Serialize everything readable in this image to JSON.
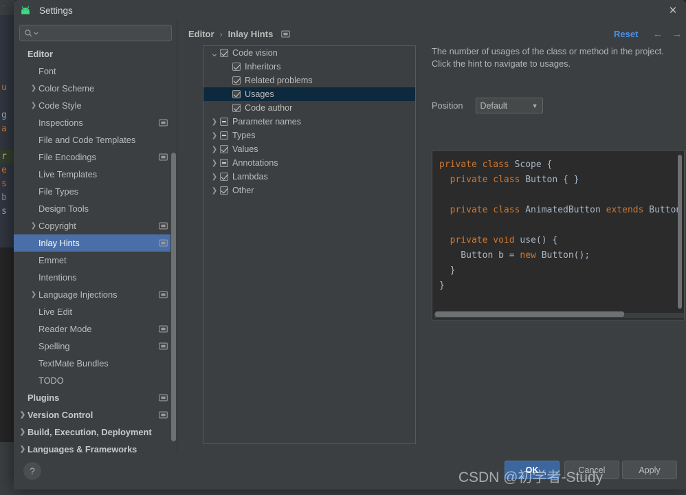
{
  "window": {
    "title": "Settings",
    "logo_icon": "android-logo-icon",
    "close_icon": "close-icon"
  },
  "search": {
    "placeholder": "",
    "value": "",
    "icon": "search-icon",
    "dropdown_icon": "chevron-down-icon"
  },
  "sidebar": {
    "scrollbar": "vertical-scrollbar",
    "items": [
      {
        "label": "Editor",
        "indent": 0,
        "bold": true,
        "arrow": "",
        "config_icon": false
      },
      {
        "label": "Font",
        "indent": 1,
        "bold": false,
        "arrow": "",
        "config_icon": false
      },
      {
        "label": "Color Scheme",
        "indent": 1,
        "bold": false,
        "arrow": "chevron-right-icon",
        "config_icon": false
      },
      {
        "label": "Code Style",
        "indent": 1,
        "bold": false,
        "arrow": "chevron-right-icon",
        "config_icon": false
      },
      {
        "label": "Inspections",
        "indent": 1,
        "bold": false,
        "arrow": "",
        "config_icon": true
      },
      {
        "label": "File and Code Templates",
        "indent": 1,
        "bold": false,
        "arrow": "",
        "config_icon": false
      },
      {
        "label": "File Encodings",
        "indent": 1,
        "bold": false,
        "arrow": "",
        "config_icon": true
      },
      {
        "label": "Live Templates",
        "indent": 1,
        "bold": false,
        "arrow": "",
        "config_icon": false
      },
      {
        "label": "File Types",
        "indent": 1,
        "bold": false,
        "arrow": "",
        "config_icon": false
      },
      {
        "label": "Design Tools",
        "indent": 1,
        "bold": false,
        "arrow": "",
        "config_icon": false
      },
      {
        "label": "Copyright",
        "indent": 1,
        "bold": false,
        "arrow": "chevron-right-icon",
        "config_icon": true
      },
      {
        "label": "Inlay Hints",
        "indent": 1,
        "bold": false,
        "arrow": "",
        "config_icon": true,
        "selected": true
      },
      {
        "label": "Emmet",
        "indent": 1,
        "bold": false,
        "arrow": "",
        "config_icon": false
      },
      {
        "label": "Intentions",
        "indent": 1,
        "bold": false,
        "arrow": "",
        "config_icon": false
      },
      {
        "label": "Language Injections",
        "indent": 1,
        "bold": false,
        "arrow": "chevron-right-icon",
        "config_icon": true
      },
      {
        "label": "Live Edit",
        "indent": 1,
        "bold": false,
        "arrow": "",
        "config_icon": false
      },
      {
        "label": "Reader Mode",
        "indent": 1,
        "bold": false,
        "arrow": "",
        "config_icon": true
      },
      {
        "label": "Spelling",
        "indent": 1,
        "bold": false,
        "arrow": "",
        "config_icon": true
      },
      {
        "label": "TextMate Bundles",
        "indent": 1,
        "bold": false,
        "arrow": "",
        "config_icon": false
      },
      {
        "label": "TODO",
        "indent": 1,
        "bold": false,
        "arrow": "",
        "config_icon": false
      },
      {
        "label": "Plugins",
        "indent": 0,
        "bold": true,
        "arrow": "",
        "config_icon": true
      },
      {
        "label": "Version Control",
        "indent": 0,
        "bold": true,
        "arrow": "chevron-right-icon",
        "config_icon": true
      },
      {
        "label": "Build, Execution, Deployment",
        "indent": 0,
        "bold": true,
        "arrow": "chevron-right-icon",
        "config_icon": false
      },
      {
        "label": "Languages & Frameworks",
        "indent": 0,
        "bold": true,
        "arrow": "chevron-right-icon",
        "config_icon": false
      }
    ]
  },
  "breadcrumb": {
    "root": "Editor",
    "separator": "›",
    "current": "Inlay Hints",
    "config_icon": "scope-indicator-icon"
  },
  "actions": {
    "reset_label": "Reset",
    "back_icon": "arrow-left-icon",
    "forward_icon": "arrow-right-icon"
  },
  "hint_tree": {
    "rows": [
      {
        "label": "Code vision",
        "indent": 0,
        "arrow": "chevron-down-icon",
        "checkbox": "checked"
      },
      {
        "label": "Inheritors",
        "indent": 1,
        "arrow": "",
        "checkbox": "checked"
      },
      {
        "label": "Related problems",
        "indent": 1,
        "arrow": "",
        "checkbox": "checked"
      },
      {
        "label": "Usages",
        "indent": 1,
        "arrow": "",
        "checkbox": "checked",
        "selected": true
      },
      {
        "label": "Code author",
        "indent": 1,
        "arrow": "",
        "checkbox": "checked"
      },
      {
        "label": "Parameter names",
        "indent": 0,
        "arrow": "chevron-right-icon",
        "checkbox": "dash"
      },
      {
        "label": "Types",
        "indent": 0,
        "arrow": "chevron-right-icon",
        "checkbox": "dash"
      },
      {
        "label": "Values",
        "indent": 0,
        "arrow": "chevron-right-icon",
        "checkbox": "checked"
      },
      {
        "label": "Annotations",
        "indent": 0,
        "arrow": "chevron-right-icon",
        "checkbox": "dash"
      },
      {
        "label": "Lambdas",
        "indent": 0,
        "arrow": "chevron-right-icon",
        "checkbox": "checked"
      },
      {
        "label": "Other",
        "indent": 0,
        "arrow": "chevron-right-icon",
        "checkbox": "checked"
      }
    ]
  },
  "detail": {
    "description": "The number of usages of the class or method in the project. Click the hint to navigate to usages.",
    "position_label": "Position",
    "position_value": "Default",
    "position_caret": "chevron-down-icon",
    "code_preview": [
      {
        "segments": [
          {
            "t": "private class ",
            "k": true
          },
          {
            "t": "Scope {",
            "k": false
          }
        ]
      },
      {
        "segments": [
          {
            "t": "  private class ",
            "k": true
          },
          {
            "t": "Button { }",
            "k": false
          }
        ]
      },
      {
        "segments": [
          {
            "t": "",
            "k": false
          }
        ]
      },
      {
        "segments": [
          {
            "t": "  private class ",
            "k": true
          },
          {
            "t": "AnimatedButton ",
            "k": false
          },
          {
            "t": "extends ",
            "k": true
          },
          {
            "t": "Button",
            "k": false
          }
        ]
      },
      {
        "segments": [
          {
            "t": "",
            "k": false
          }
        ]
      },
      {
        "segments": [
          {
            "t": "  private void ",
            "k": true
          },
          {
            "t": "use() {",
            "k": false
          }
        ]
      },
      {
        "segments": [
          {
            "t": "    Button b = ",
            "k": false
          },
          {
            "t": "new ",
            "k": true
          },
          {
            "t": "Button();",
            "k": false
          }
        ]
      },
      {
        "segments": [
          {
            "t": "  }",
            "k": false
          }
        ]
      },
      {
        "segments": [
          {
            "t": "}",
            "k": false
          }
        ]
      }
    ]
  },
  "footer": {
    "help_label": "?",
    "ok_label": "OK",
    "cancel_label": "Cancel",
    "apply_label": "Apply"
  },
  "watermark": {
    "text": "CSDN @初学者-Study"
  },
  "background_editor": {
    "lines": [
      "u",
      "",
      "g",
      "a",
      "",
      "r",
      "e",
      "s",
      "b",
      "s"
    ]
  },
  "colors": {
    "accent_blue": "#4d90e8",
    "selection_blue": "#4a6fa8",
    "tree_selection": "#0d293e",
    "keyword_orange": "#cc7832",
    "panel_bg": "#3c3f41",
    "code_bg": "#2b2b2b"
  }
}
